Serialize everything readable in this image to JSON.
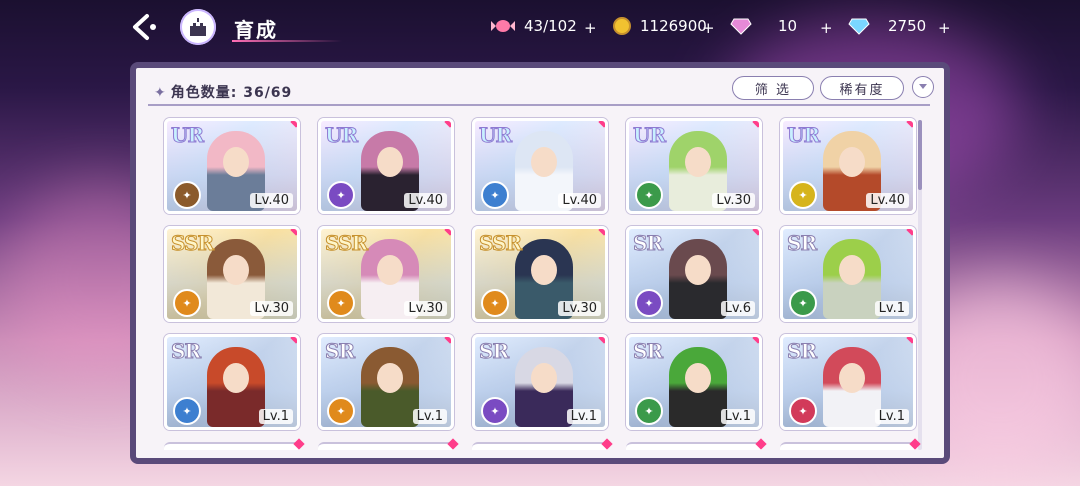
{
  "header": {
    "title": "育成",
    "resources": [
      {
        "icon": "candy-icon",
        "value": "43/102"
      },
      {
        "icon": "gold-coin-icon",
        "value": "1126900"
      },
      {
        "icon": "pink-diamond-icon",
        "value": "10"
      },
      {
        "icon": "blue-diamond-icon",
        "value": "2750"
      }
    ]
  },
  "panel": {
    "count_label": "角色数量: 36/69",
    "filter_label": "筛 选",
    "rarity_label": "稀有度"
  },
  "cards": [
    {
      "rarity": "UR",
      "level": "Lv.40",
      "attr_color": "#8b5a2b",
      "hair": "#f2b8c6",
      "outfit": "#6b7d99"
    },
    {
      "rarity": "UR",
      "level": "Lv.40",
      "attr_color": "#7a4bc2",
      "hair": "#c77aa8",
      "outfit": "#2a2230"
    },
    {
      "rarity": "UR",
      "level": "Lv.40",
      "attr_color": "#3d7fd0",
      "hair": "#dde6f4",
      "outfit": "#f3f6fb"
    },
    {
      "rarity": "UR",
      "level": "Lv.30",
      "attr_color": "#3b9a4a",
      "hair": "#9fd36a",
      "outfit": "#e8eddc"
    },
    {
      "rarity": "UR",
      "level": "Lv.40",
      "attr_color": "#d6b41c",
      "hair": "#f0d2a6",
      "outfit": "#b44a2a"
    },
    {
      "rarity": "SSR",
      "level": "Lv.30",
      "attr_color": "#e08a1c",
      "hair": "#8a5a3a",
      "outfit": "#f2e8d8"
    },
    {
      "rarity": "SSR",
      "level": "Lv.30",
      "attr_color": "#e08a1c",
      "hair": "#d68ab8",
      "outfit": "#f6eef2"
    },
    {
      "rarity": "SSR",
      "level": "Lv.30",
      "attr_color": "#e08a1c",
      "hair": "#2a3552",
      "outfit": "#3a5a6a"
    },
    {
      "rarity": "SR",
      "level": "Lv.6",
      "attr_color": "#7a4bc2",
      "hair": "#6a4a4e",
      "outfit": "#2a2a2e"
    },
    {
      "rarity": "SR",
      "level": "Lv.1",
      "attr_color": "#3b9a4a",
      "hair": "#9ccf4a",
      "outfit": "#c9d2bf"
    },
    {
      "rarity": "SR",
      "level": "Lv.1",
      "attr_color": "#3d7fd0",
      "hair": "#c84a2a",
      "outfit": "#7a2a2a"
    },
    {
      "rarity": "SR",
      "level": "Lv.1",
      "attr_color": "#e08a1c",
      "hair": "#8a5a32",
      "outfit": "#4a5a2a"
    },
    {
      "rarity": "SR",
      "level": "Lv.1",
      "attr_color": "#7a4bc2",
      "hair": "#d8d8e4",
      "outfit": "#3a2a5a"
    },
    {
      "rarity": "SR",
      "level": "Lv.1",
      "attr_color": "#3b9a4a",
      "hair": "#4aa83a",
      "outfit": "#2a2a2a"
    },
    {
      "rarity": "SR",
      "level": "Lv.1",
      "attr_color": "#d23a5a",
      "hair": "#d24a5a",
      "outfit": "#f2f2f6"
    }
  ]
}
